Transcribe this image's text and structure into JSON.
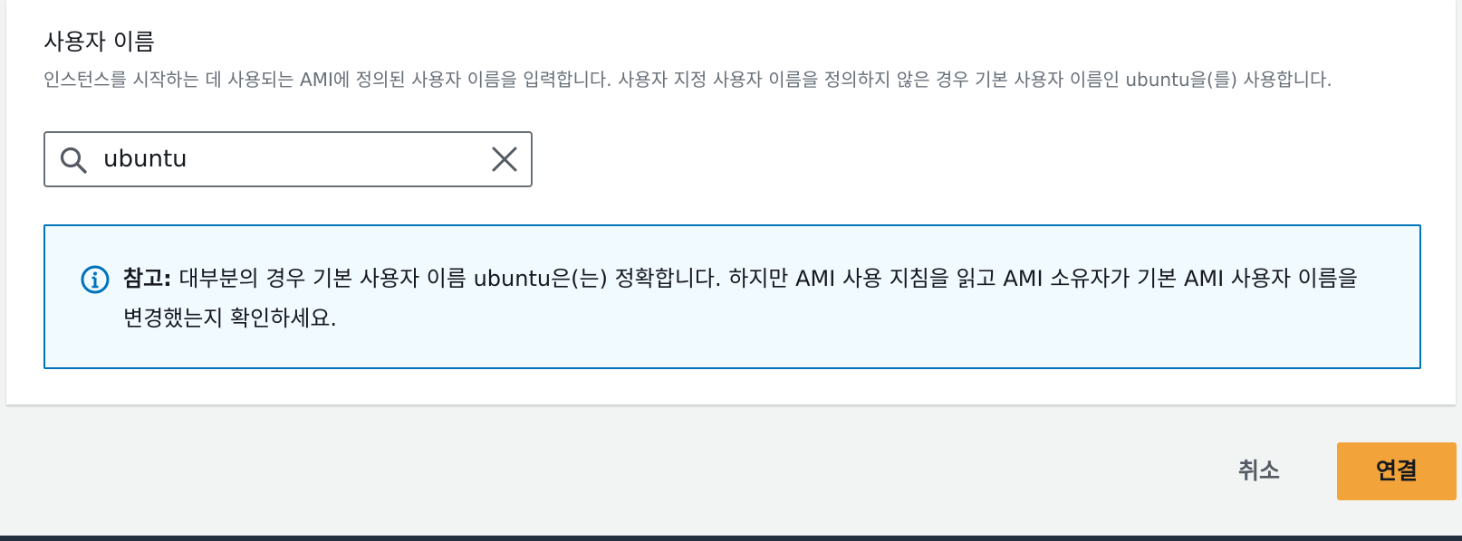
{
  "username_field": {
    "label": "사용자 이름",
    "description": "인스턴스를 시작하는 데 사용되는 AMI에 정의된 사용자 이름을 입력합니다. 사용자 지정 사용자 이름을 정의하지 않은 경우 기본 사용자 이름인 ubuntu을(를) 사용합니다.",
    "value": "ubuntu",
    "icon": "search-icon",
    "clear_icon": "close-icon"
  },
  "alert": {
    "icon": "info-icon",
    "label": "참고:",
    "text": " 대부분의 경우 기본 사용자 이름 ubuntu은(는) 정확합니다. 하지만 AMI 사용 지침을 읽고 AMI 소유자가 기본 AMI 사용자 이름을 변경했는지 확인하세요."
  },
  "actions": {
    "cancel_label": "취소",
    "connect_label": "연결"
  },
  "colors": {
    "primary_button": "#f2a33a",
    "info_border": "#0073bb",
    "info_background": "#f1faff",
    "page_background": "#f2f3f3"
  }
}
